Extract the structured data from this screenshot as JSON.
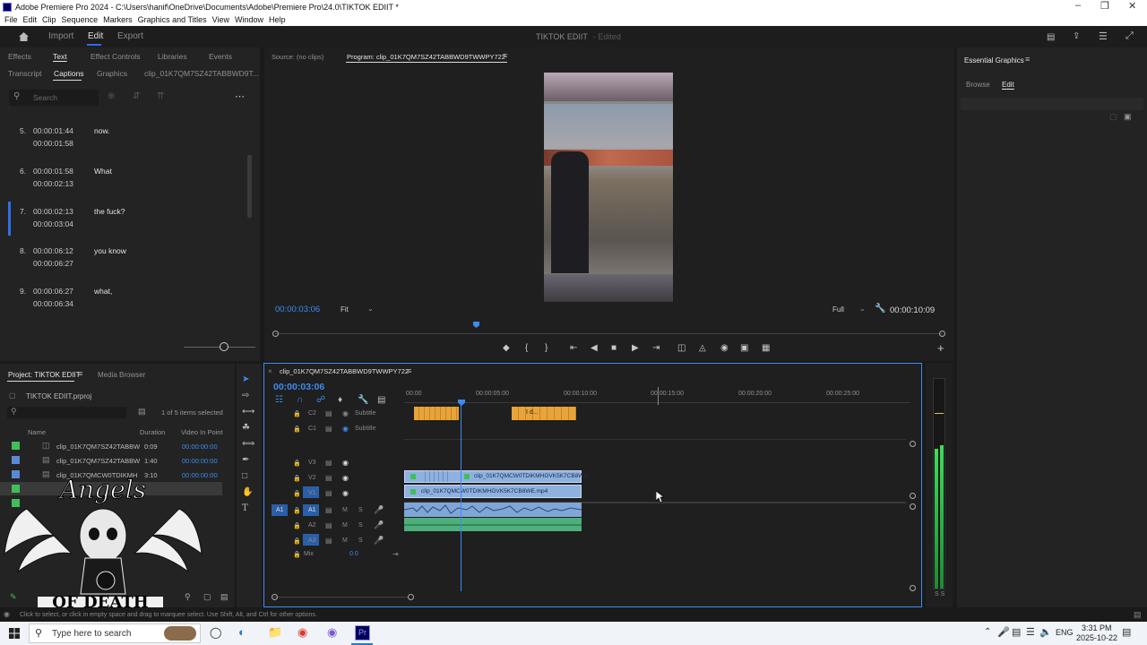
{
  "window": {
    "title": "Adobe Premiere Pro 2024 - C:\\Users\\hanif\\OneDrive\\Documents\\Adobe\\Premiere Pro\\24.0\\TIKTOK EDIIT *"
  },
  "menu": [
    "File",
    "Edit",
    "Clip",
    "Sequence",
    "Markers",
    "Graphics and Titles",
    "View",
    "Window",
    "Help"
  ],
  "workspace": {
    "tabs": [
      "Import",
      "Edit",
      "Export"
    ],
    "active": "Edit",
    "project_title": "TIKTOK EDIIT",
    "status": "- Edited"
  },
  "left_panel": {
    "tabs_row1": [
      "Effects",
      "Text",
      "Effect Controls",
      "Libraries",
      "Events"
    ],
    "tabs_row2": [
      "Transcript",
      "Captions",
      "Graphics",
      "clip_01K7QM7SZ42TABBWD9T..."
    ],
    "search_placeholder": "Search",
    "captions": [
      {
        "n": "5.",
        "start": "00:00:01:44",
        "end": "00:00:01:58",
        "text": "now."
      },
      {
        "n": "6.",
        "start": "00:00:01:58",
        "end": "00:00:02:13",
        "text": "What"
      },
      {
        "n": "7.",
        "start": "00:00:02:13",
        "end": "00:00:03:04",
        "text": "the fuck?"
      },
      {
        "n": "8.",
        "start": "00:00:06:12",
        "end": "00:00:06:27",
        "text": "you know"
      },
      {
        "n": "9.",
        "start": "00:00:06:27",
        "end": "00:00:06:34",
        "text": "what,"
      }
    ]
  },
  "source_monitor": {
    "label": "Source: (no clips)"
  },
  "program_monitor": {
    "label": "Program: clip_01K7QM7SZ42TABBWD9TWWPY722",
    "timecode": "00:00:03:06",
    "fit": "Fit",
    "quality": "Full",
    "duration": "00:00:10:09"
  },
  "essential_graphics": {
    "title": "Essential Graphics",
    "tabs": [
      "Browse",
      "Edit"
    ]
  },
  "project": {
    "tabs": [
      "Project: TIKTOK EDIIT",
      "Media Browser"
    ],
    "file": "TIKTOK EDIIT.prproj",
    "count": "1 of 5 items selected",
    "columns": [
      "Name",
      "Duration",
      "Video In Point"
    ],
    "items": [
      {
        "name": "clip_01K7QM7SZ42TABBW",
        "duration": "0:09",
        "in": "00:00:00:00",
        "color": "#3fbf5a"
      },
      {
        "name": "clip_01K7QM7SZ42TABBW",
        "duration": "1:40",
        "in": "00:00:00:00",
        "color": "#5a8ad6"
      },
      {
        "name": "clip_01K7QMCW0TDIKMH",
        "duration": "3:10",
        "in": "00:00:00:00",
        "color": "#5a8ad6"
      }
    ]
  },
  "timeline": {
    "sequence_name": "clip_01K7QM7SZ42TABBWD9TWWPY722",
    "timecode": "00:00:03:06",
    "ruler": [
      "00:00",
      "00:00:05:00",
      "00:00:10:00",
      "00:00:15:00",
      "00:00:20:00",
      "00:00:25:00"
    ],
    "caption_tracks": [
      {
        "name": "C2",
        "label": "Subtitle"
      },
      {
        "name": "C1",
        "label": "Subtitle"
      }
    ],
    "video_tracks": [
      "V3",
      "V2",
      "V1"
    ],
    "audio_tracks": [
      "A1",
      "A2",
      "A3"
    ],
    "mix_label": "Mix",
    "mix_value": "0.0",
    "clip_v2": "clip_01K7QMCW0TDIKMHGVK5K7CB8WE",
    "clip_v1": "clip_01K7QMCW0TDIKMHGVK5K7CB8WE.mp4",
    "caption_clip_text": "I d..."
  },
  "status_bar": "Click to select, or click in empty space and drag to marquee select. Use Shift, Alt, and Ctrl for other options.",
  "watermark": {
    "text_top": "Angels",
    "text_bottom": "OF DEATH"
  },
  "taskbar": {
    "search_placeholder": "Type here to search",
    "lang": "ENG",
    "time": "3:31 PM",
    "date": "2025-10-22"
  },
  "meters": {
    "scale": "S S"
  }
}
